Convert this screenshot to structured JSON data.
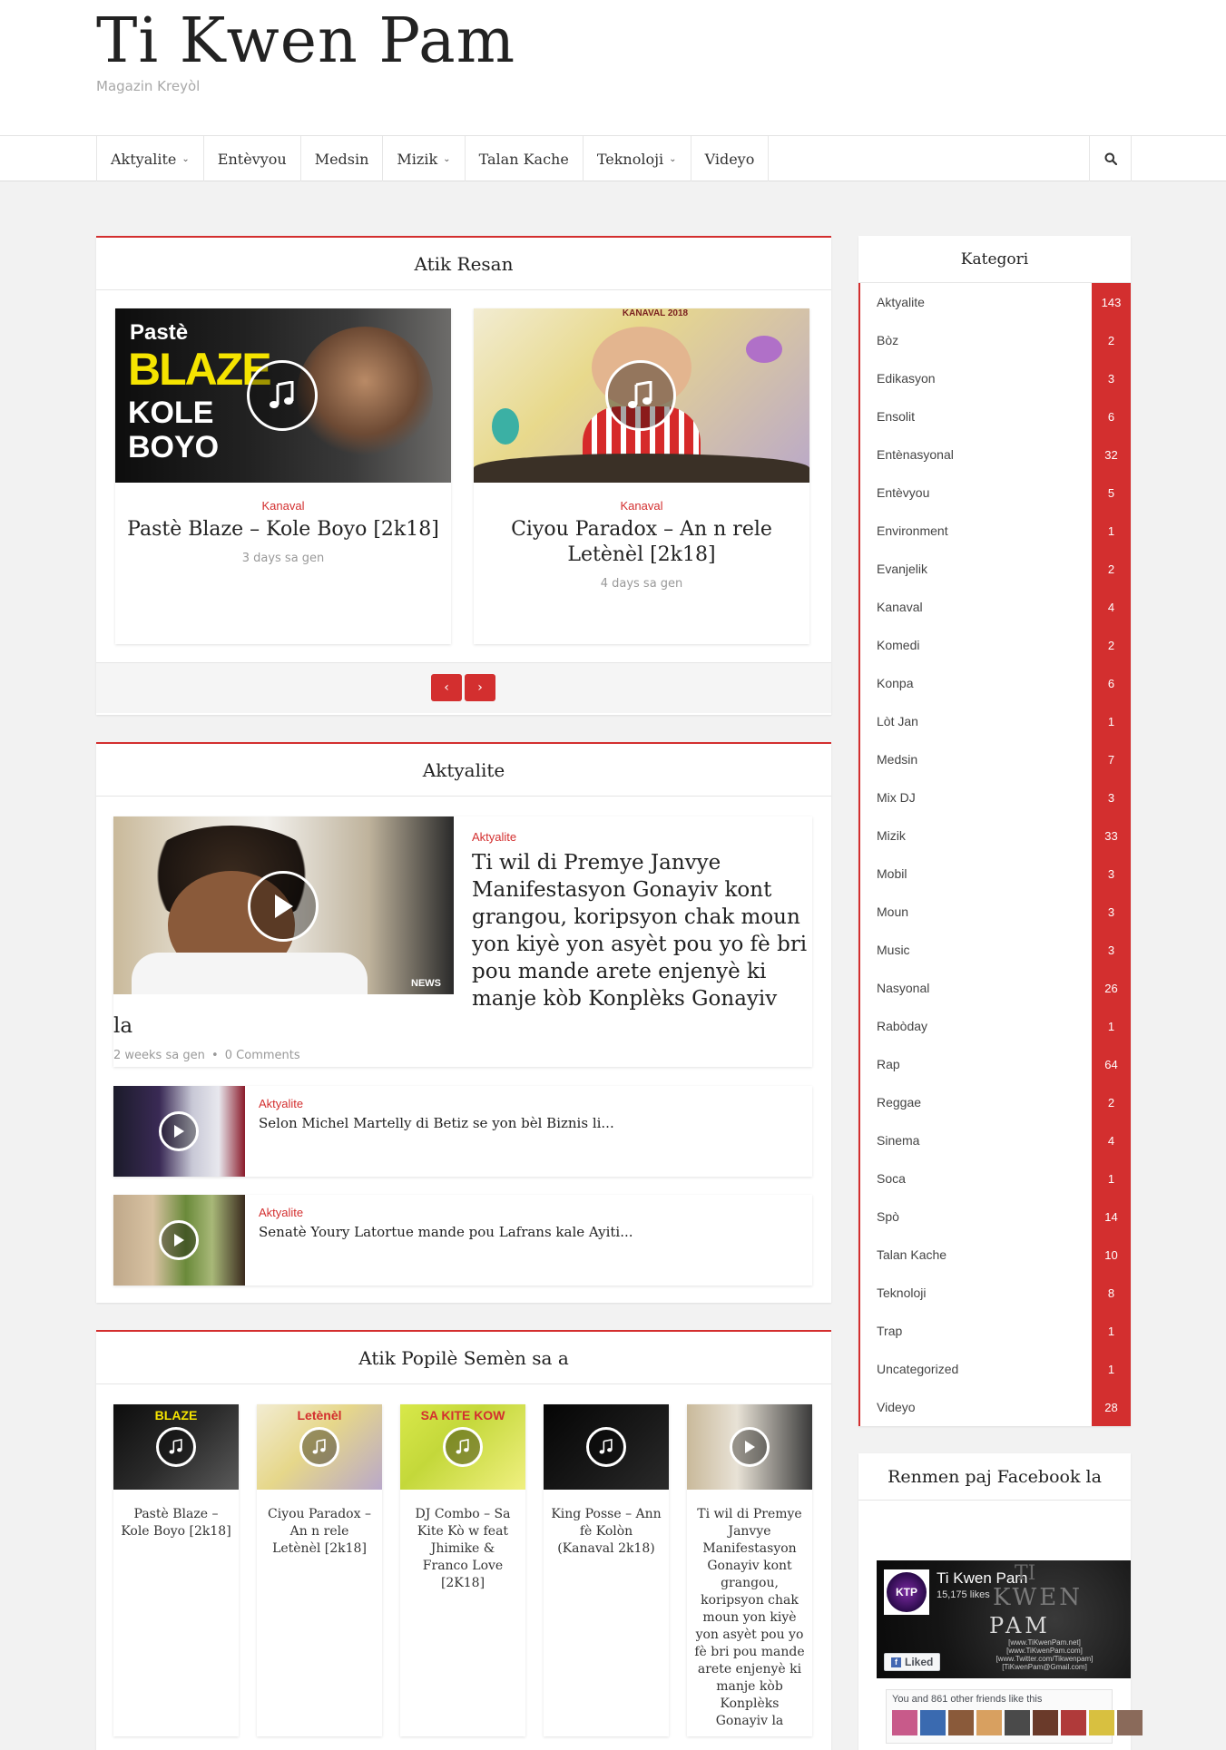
{
  "site": {
    "title": "Ti Kwen Pam",
    "tagline": "Magazin Kreyòl"
  },
  "nav": {
    "items": [
      {
        "label": "Aktyalite",
        "dropdown": true
      },
      {
        "label": "Entèvyou",
        "dropdown": false
      },
      {
        "label": "Medsin",
        "dropdown": false
      },
      {
        "label": "Mizik",
        "dropdown": true
      },
      {
        "label": "Talan Kache",
        "dropdown": false
      },
      {
        "label": "Teknoloji",
        "dropdown": true
      },
      {
        "label": "Videyo",
        "dropdown": false
      }
    ],
    "search_icon": "search-icon"
  },
  "recent": {
    "heading": "Atik Resan",
    "posts": [
      {
        "category": "Kanaval",
        "title": "Pastè Blaze – Kole Boyo [2k18]",
        "time": "3 days sa gen",
        "thumb_text_1": "Pastè",
        "thumb_text_2": "BLAZE",
        "thumb_text_3": "KOLE",
        "thumb_text_4": "BOYO"
      },
      {
        "category": "Kanaval",
        "title": "Ciyou Paradox – An n rele Letènèl [2k18]",
        "time": "4 days sa gen",
        "thumb_text_1": "KANAVAL 2018"
      }
    ],
    "prev_label": "‹",
    "next_label": "›"
  },
  "news": {
    "heading": "Aktyalite",
    "featured": {
      "category": "Aktyalite",
      "title": "Ti wil di Premye Janvye Manifestasyon Gonayiv kont grangou, koripsyon chak moun yon kiyè yon asyèt pou yo fè bri pou mande arete enjenyè ki manje kòb Konplèks Gonayiv la",
      "time": "2 weeks sa gen",
      "comments": "0 Comments",
      "thumb_badge": "NEWS"
    },
    "items": [
      {
        "category": "Aktyalite",
        "title": "Selon Michel Martelly di Betiz se yon bèl Biznis li..."
      },
      {
        "category": "Aktyalite",
        "title": "Senatè Youry Latortue mande pou Lafrans kale Ayiti..."
      }
    ]
  },
  "popular": {
    "heading": "Atik Popilè Semèn sa a",
    "items": [
      {
        "title": "Pastè Blaze – Kole Boyo [2k18]",
        "thumb_text": "BLAZE"
      },
      {
        "title": "Ciyou Paradox – An n rele Letènèl [2k18]",
        "thumb_text": "Letènèl"
      },
      {
        "title": "DJ Combo – Sa Kite Kò w feat Jhimike & Franco Love [2K18]",
        "thumb_text": "SA KITE KOW"
      },
      {
        "title": "King Posse – Ann fè Kolòn (Kanaval 2k18)",
        "thumb_text": ""
      },
      {
        "title": "Ti wil di Premye Janvye Manifestasyon Gonayiv kont grangou, koripsyon chak moun yon kiyè yon asyèt pou yo fè bri pou mande arete enjenyè ki manje kòb Konplèks Gonayiv la",
        "thumb_text": ""
      }
    ]
  },
  "sidebar": {
    "categories_heading": "Kategori",
    "categories": [
      {
        "name": "Aktyalite",
        "count": "143"
      },
      {
        "name": "Bòz",
        "count": "2"
      },
      {
        "name": "Edikasyon",
        "count": "3"
      },
      {
        "name": "Ensolit",
        "count": "6"
      },
      {
        "name": "Entènasyonal",
        "count": "32"
      },
      {
        "name": "Entèvyou",
        "count": "5"
      },
      {
        "name": "Environment",
        "count": "1"
      },
      {
        "name": "Evanjelik",
        "count": "2"
      },
      {
        "name": "Kanaval",
        "count": "4"
      },
      {
        "name": "Komedi",
        "count": "2"
      },
      {
        "name": "Konpa",
        "count": "6"
      },
      {
        "name": "Lòt Jan",
        "count": "1"
      },
      {
        "name": "Medsin",
        "count": "7"
      },
      {
        "name": "Mix DJ",
        "count": "3"
      },
      {
        "name": "Mizik",
        "count": "33"
      },
      {
        "name": "Mobil",
        "count": "3"
      },
      {
        "name": "Moun",
        "count": "3"
      },
      {
        "name": "Music",
        "count": "3"
      },
      {
        "name": "Nasyonal",
        "count": "26"
      },
      {
        "name": "Rabòday",
        "count": "1"
      },
      {
        "name": "Rap",
        "count": "64"
      },
      {
        "name": "Reggae",
        "count": "2"
      },
      {
        "name": "Sinema",
        "count": "4"
      },
      {
        "name": "Soca",
        "count": "1"
      },
      {
        "name": "Spò",
        "count": "14"
      },
      {
        "name": "Talan Kache",
        "count": "10"
      },
      {
        "name": "Teknoloji",
        "count": "8"
      },
      {
        "name": "Trap",
        "count": "1"
      },
      {
        "name": "Uncategorized",
        "count": "1"
      },
      {
        "name": "Videyo",
        "count": "28"
      }
    ],
    "facebook_heading": "Renmen paj Facebook la",
    "facebook": {
      "page_name": "Ti Kwen Pam",
      "likes": "15,175 likes",
      "liked_label": "Liked",
      "cover_text_1": "TI",
      "cover_text_2": "KWEN",
      "cover_text_3": "PAM",
      "cover_links": "[www.TiKwenPam.net]\n[www.TiKwenPam.com]\n[www.Twitter.com/Tikwenpam]\n[TiKwenPam@Gmail.com]",
      "friends_text": "You and 861 other friends like this",
      "logo_text": "KTP"
    }
  },
  "colors": {
    "accent": "#d32f2f",
    "background": "#f2f2f2"
  }
}
